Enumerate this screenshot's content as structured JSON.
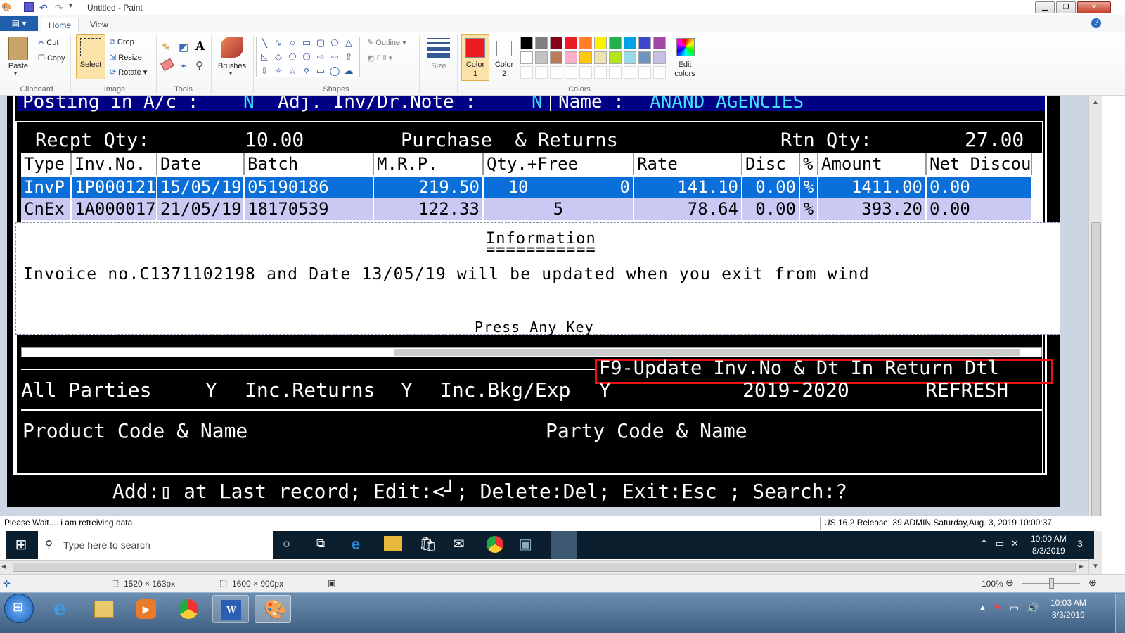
{
  "window": {
    "title": "Untitled - Paint"
  },
  "ribbon": {
    "file_label": "▤ ▾",
    "tabs": [
      {
        "label": "Home"
      },
      {
        "label": "View"
      }
    ],
    "clipboard": {
      "paste": "Paste",
      "cut": "Cut",
      "copy": "Copy",
      "group": "Clipboard"
    },
    "image": {
      "select": "Select",
      "crop": "Crop",
      "resize": "Resize",
      "rotate": "Rotate",
      "group": "Image"
    },
    "tools": {
      "group": "Tools"
    },
    "brushes": "Brushes",
    "shapes": {
      "outline": "Outline",
      "fill": "Fill",
      "group": "Shapes"
    },
    "size": "Size",
    "color1": "Color\n1",
    "color2": "Color\n2",
    "colors_group": "Colors",
    "edit_colors": "Edit\ncolors",
    "palette_row1": [
      "#000000",
      "#7f7f7f",
      "#880015",
      "#ed1c24",
      "#ff7f27",
      "#fff200",
      "#22b14c",
      "#00a2e8",
      "#3f48cc",
      "#a349a4"
    ],
    "palette_row2": [
      "#ffffff",
      "#c3c3c3",
      "#b97a57",
      "#ffaec9",
      "#ffc90e",
      "#efe4b0",
      "#b5e61d",
      "#99d9ea",
      "#7092be",
      "#c8bfe7"
    ],
    "color1_hex": "#ed1c24"
  },
  "dos": {
    "posting_line": "Posting in A/c : ",
    "posting_val": "N",
    "adj_label": "  Adj. Inv/Dr.Note : ",
    "adj_val": "N",
    "name_label": "Name : ",
    "name_val": "ANAND AGENCIES",
    "recpt_label": "Recpt Qty:",
    "recpt_val": "10.00",
    "section_title": "Purchase  & Returns",
    "rtn_label": "Rtn Qty:",
    "rtn_val": "27.00",
    "columns": [
      "Type",
      "Inv.No.",
      "Date",
      "Batch",
      "M.R.P.",
      "Qty.+Free",
      "Rate",
      "Disc",
      "%",
      "Amount",
      "Net Discou"
    ],
    "rows": [
      {
        "type": "InvP",
        "inv": "1P000121",
        "date": "15/05/19",
        "batch": "05190186",
        "mrp": "219.50",
        "qty": "10",
        "free": "0",
        "rate": "141.10",
        "disc": "0.00",
        "pct": "%",
        "amount": "1411.00",
        "net": "0.00"
      },
      {
        "type": "CnEx",
        "inv": "1A000017",
        "date": "21/05/19",
        "batch": "18170539",
        "mrp": "122.33",
        "qty": "5",
        "free": "",
        "rate": "78.64",
        "disc": "0.00",
        "pct": "%",
        "amount": "393.20",
        "net": "0.00"
      }
    ],
    "info_title": "Information",
    "info_underline": "===========",
    "info_msg": "Invoice no.C1371102198 and Date 13/05/19 will be updated when you exit from wind",
    "info_press": "Press Any Key",
    "f9_label": "F9-Update Inv.No & Dt In Return Dtl",
    "all_parties": "All Parties",
    "all_parties_val": "Y",
    "inc_returns": "Inc.Returns",
    "inc_returns_val": "Y",
    "inc_bkg": "Inc.Bkg/Exp",
    "inc_bkg_val": "Y",
    "year": "2019-2020",
    "refresh": "REFRESH",
    "product_label": "Product Code & Name",
    "party_label": "Party Code & Name",
    "footer": "Add:▯ at Last record; Edit:<┘; Delete:Del; Exit:Esc ; Search:?"
  },
  "inner_status": {
    "left": "Please Wait.... i am retreiving data",
    "right": "US 16.2 Release: 39 ADMIN  Saturday,Aug.  3, 2019 10:00:37"
  },
  "inner_taskbar": {
    "search_placeholder": "Type here to search",
    "time": "10:00 AM",
    "date": "8/3/2019",
    "notif": "3"
  },
  "statusbar": {
    "selection_size": "1520 × 163px",
    "image_size": "1600 × 900px",
    "zoom": "100%"
  },
  "taskbar": {
    "time": "10:03 AM",
    "date": "8/3/2019"
  }
}
